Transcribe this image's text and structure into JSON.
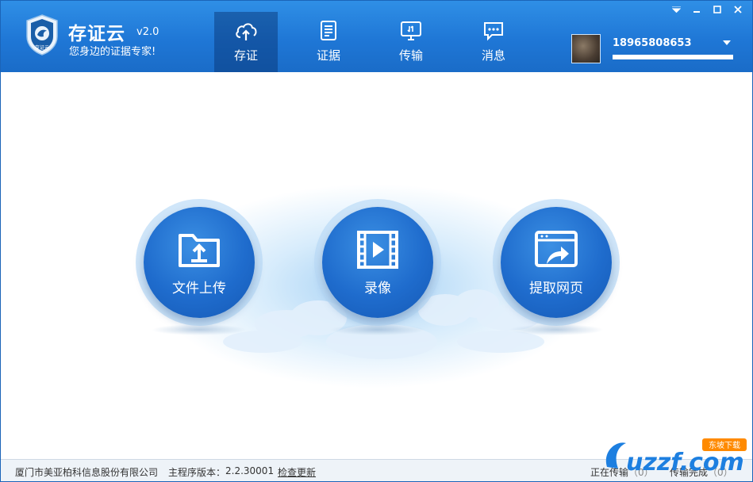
{
  "header": {
    "app_name": "存证云",
    "version": "v2.0",
    "slogan": "您身边的证据专家!",
    "logo_text": "存证云"
  },
  "nav": {
    "tabs": [
      {
        "label": "存证",
        "icon": "cloud-upload-icon",
        "active": true
      },
      {
        "label": "证据",
        "icon": "document-icon",
        "active": false
      },
      {
        "label": "传输",
        "icon": "transfer-icon",
        "active": false
      },
      {
        "label": "消息",
        "icon": "message-icon",
        "active": false
      }
    ]
  },
  "user": {
    "phone": "18965808653",
    "storage_used_fraction": 1.0
  },
  "window_controls": [
    "dropdown-icon",
    "minimize-icon",
    "maximize-icon",
    "close-icon"
  ],
  "actions": [
    {
      "label": "文件上传",
      "icon": "folder-upload-icon"
    },
    {
      "label": "录像",
      "icon": "video-icon"
    },
    {
      "label": "提取网页",
      "icon": "web-capture-icon"
    }
  ],
  "statusbar": {
    "company": "厦门市美亚柏科信息股份有限公司",
    "version_label": "主程序版本：",
    "version": "2.2.30001",
    "check_update": "检查更新",
    "transferring_label": "正在传输",
    "transferring_count": "（0）",
    "done_label": "传输完成",
    "done_count": "（0）"
  },
  "watermark": {
    "text": "uzzf.com",
    "tag": "东坡下载"
  },
  "colors": {
    "header_blue": "#1f77d6",
    "button_blue": "#1f6ccd",
    "statusbar_bg": "#eef3f8"
  }
}
